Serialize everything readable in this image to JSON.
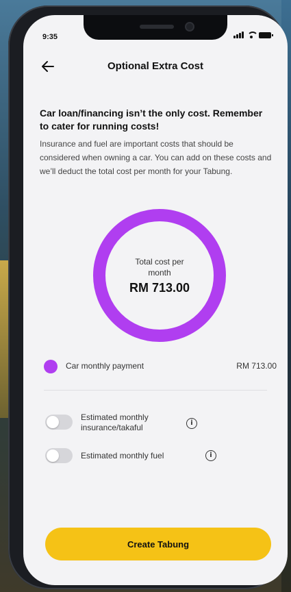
{
  "status_bar": {
    "time": "9:35"
  },
  "header": {
    "title": "Optional Extra Cost",
    "back_icon": "arrow-left-icon"
  },
  "intro": {
    "title": "Car loan/financing isn’t the only cost. Remember to cater for running costs!",
    "description": "Insurance and fuel are important costs that should be considered when owning a car. You can add on these costs and we’ll deduct the total cost per month for your Tabung."
  },
  "summary": {
    "label": "Total cost per month",
    "value": "RM 713.00",
    "ring_color": "#b03ef0"
  },
  "breakdown": [
    {
      "label": "Car monthly payment",
      "value": "RM 713.00",
      "color": "#b03ef0"
    }
  ],
  "options": [
    {
      "label": "Estimated monthly insurance/takaful",
      "enabled": false,
      "info_icon": "info-icon"
    },
    {
      "label": "Estimated monthly fuel",
      "enabled": false,
      "info_icon": "info-icon"
    }
  ],
  "cta": {
    "label": "Create Tabung",
    "color": "#f5c216"
  }
}
